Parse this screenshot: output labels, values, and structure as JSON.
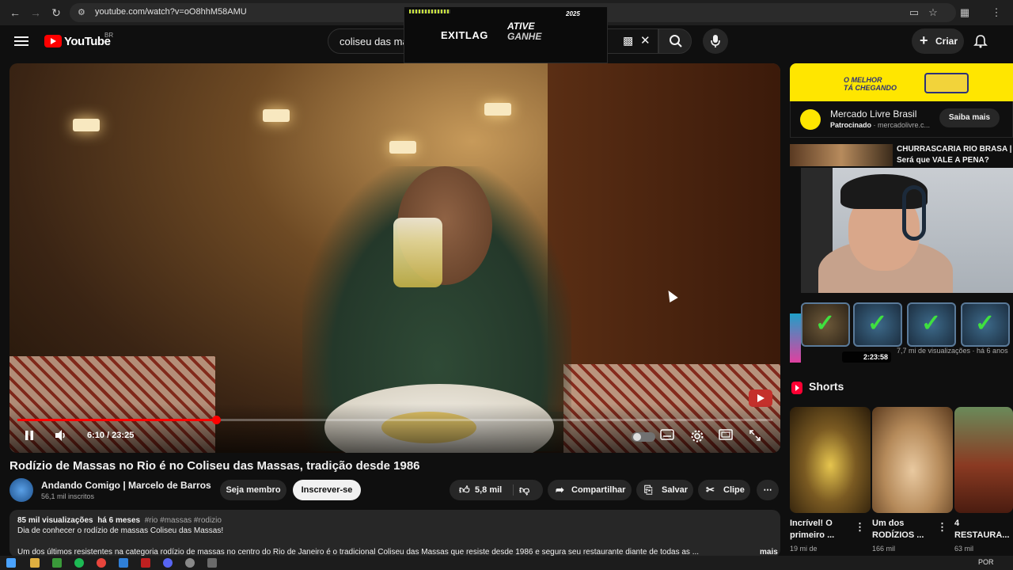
{
  "browser": {
    "url": "youtube.com/watch?v=oO8hhM58AMU"
  },
  "header": {
    "logo_text": "YouTube",
    "region": "BR",
    "search_query": "coliseu das ma",
    "create_label": "Criar"
  },
  "overlay_ad": {
    "brand": "EXITLAG",
    "tagline_1": "ATIVE",
    "tagline_2": "GANHE",
    "year": "2025"
  },
  "player": {
    "time": "6:10 / 23:25",
    "progress_fraction": 0.263
  },
  "video": {
    "title": "Rodízio de Massas no Rio é no Coliseu das Massas, tradição desde 1986",
    "channel_name": "Andando Comigo | Marcelo de Barros",
    "subscribers": "56,1 mil inscritos",
    "member_label": "Seja membro",
    "subscribe_label": "Inscrever-se",
    "likes": "5,8 mil",
    "share_label": "Compartilhar",
    "save_label": "Salvar",
    "clip_label": "Clipe"
  },
  "description": {
    "views": "85 mil visualizações",
    "age": "há 6 meses",
    "tags": "#rio #massas #rodizio",
    "line1": "Dia de conhecer o rodízio de massas Coliseu das Massas!",
    "line2": "Um dos últimos resistentes na categoria rodízio de massas no centro do Rio de Janeiro é o tradicional Coliseu das Massas que resiste desde 1986 e segura seu restaurante diante de todas as ...",
    "more_label": "mais"
  },
  "sidebar": {
    "ad": {
      "banner_line1": "O MELHOR",
      "banner_line2": "TÁ CHEGANDO",
      "name": "Mercado Livre Brasil",
      "sponsored": "Patrocinado",
      "domain": "· mercadolivre.c...",
      "cta": "Saiba mais"
    },
    "rec1": {
      "title": "CHURRASCARIA RIO BRASA | Será que VALE A PENA?",
      "duration": "2:23:58",
      "meta": "7,7 mi de visualizações · há 6 anos"
    },
    "shorts_heading": "Shorts",
    "shorts": [
      {
        "title": "Incrível! O primeiro ...",
        "views": "19 mi de"
      },
      {
        "title": "Um dos RODÍZIOS ...",
        "views": "166 mil"
      },
      {
        "title": "4 RESTAURA...",
        "views": "63 mil"
      }
    ]
  },
  "taskbar": {
    "lang": "POR"
  },
  "colors": {
    "accent": "#ff0000",
    "background": "#0f0f0f",
    "ad_yellow": "#ffe600"
  }
}
